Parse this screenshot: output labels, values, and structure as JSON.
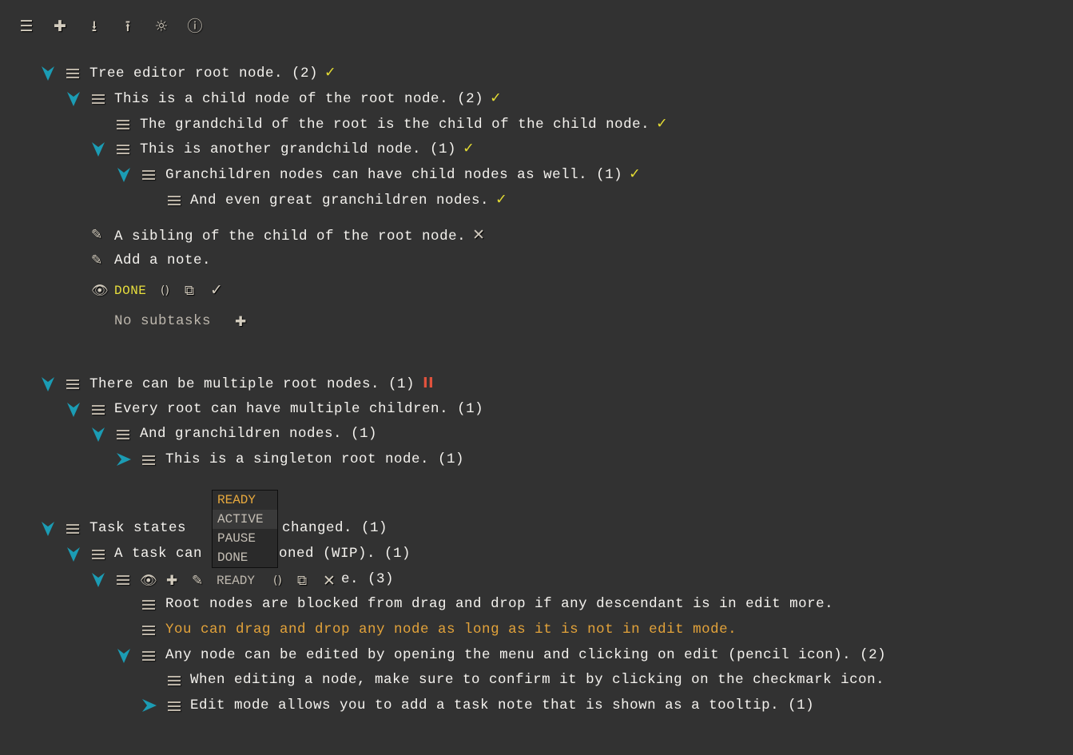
{
  "toolbar": {
    "menu_icon": "☰",
    "add_icon": "✚",
    "import_icon": "⭳",
    "export_icon": "⭱",
    "settings_icon": "☼",
    "info_icon": "ⓘ"
  },
  "tree1": {
    "root": "Tree editor root node. (2)",
    "child": "This is a child node of the root node. (2)",
    "grandchild1": "The grandchild of the root is the child of the child node.",
    "grandchild2": "This is another grandchild node. (1)",
    "great1": "Granchildren nodes can have child nodes as well. (1)",
    "great2": "And even great granchildren nodes.",
    "sibling": "A sibling of the child of the root node.",
    "add_note": "Add a note.",
    "status": "DONE",
    "no_subtasks": "No subtasks",
    "check": "✓"
  },
  "tree2": {
    "root": "There can be multiple root nodes. (1)",
    "child": "Every root can have multiple children. (1)",
    "grandchild": "And granchildren nodes. (1)",
    "singleton": "This is a singleton root node. (1)",
    "pause": "II"
  },
  "tree3": {
    "root_a": "Task states ",
    "root_b": "changed. (1)",
    "child_a": "A task can",
    "child_b": "oned (WIP). (1)",
    "edit_status": "READY",
    "edit_tail": "e. (3)",
    "item1": "Root nodes are blocked from drag and drop if any descendant is in edit more.",
    "item2": "You can drag and drop any node as long as it is not in edit mode.",
    "item3": "Any node can be edited by opening the menu and clicking on edit (pencil icon). (2)",
    "item3a": "When editing a node, make sure to confirm it by clicking on the checkmark icon.",
    "item3b": "Edit mode allows you to add a task note that is shown as a tooltip. (1)"
  },
  "dropdown": {
    "options": [
      "READY",
      "ACTIVE",
      "PAUSE",
      "DONE"
    ]
  },
  "colors": {
    "background": "#323232",
    "chevron": "#1b9cb4",
    "check": "#e4dc33",
    "pause": "#e0523d",
    "highlight": "#e3a33a"
  }
}
